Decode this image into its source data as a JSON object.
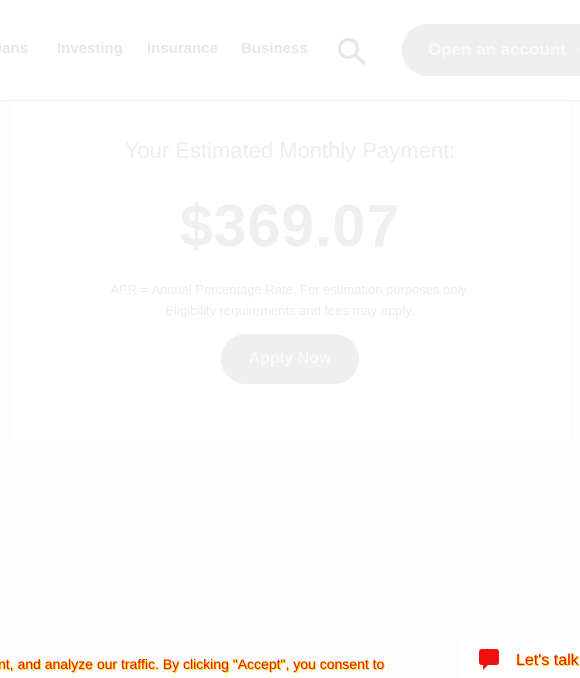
{
  "header": {
    "nav": {
      "loans": "oans",
      "investing": "Investing",
      "insurance": "Insurance",
      "business": "Business"
    },
    "search_icon": "search-icon",
    "open_account_label": "Open an account",
    "chevron_icon": "chevron-down-icon"
  },
  "card": {
    "title": "Your Estimated Monthly Payment:",
    "amount": "$369.07",
    "disclaimer_line1": "APR = Annual Percentage Rate. For estimation purposes only.",
    "disclaimer_line2": "Eligibility requirements and fees may apply.",
    "apply_label": "Apply Now"
  },
  "cookie_banner": {
    "text": "nt, and analyze our traffic. By clicking \"Accept\", you consent to"
  },
  "chat": {
    "label": "Let's talk",
    "icon": "chat-bubble-icon",
    "color": "#f01010"
  },
  "colors": {
    "faded_text": "#eeeeee",
    "alert_red": "#f01010",
    "highlight_yellow": "#f5d800"
  }
}
